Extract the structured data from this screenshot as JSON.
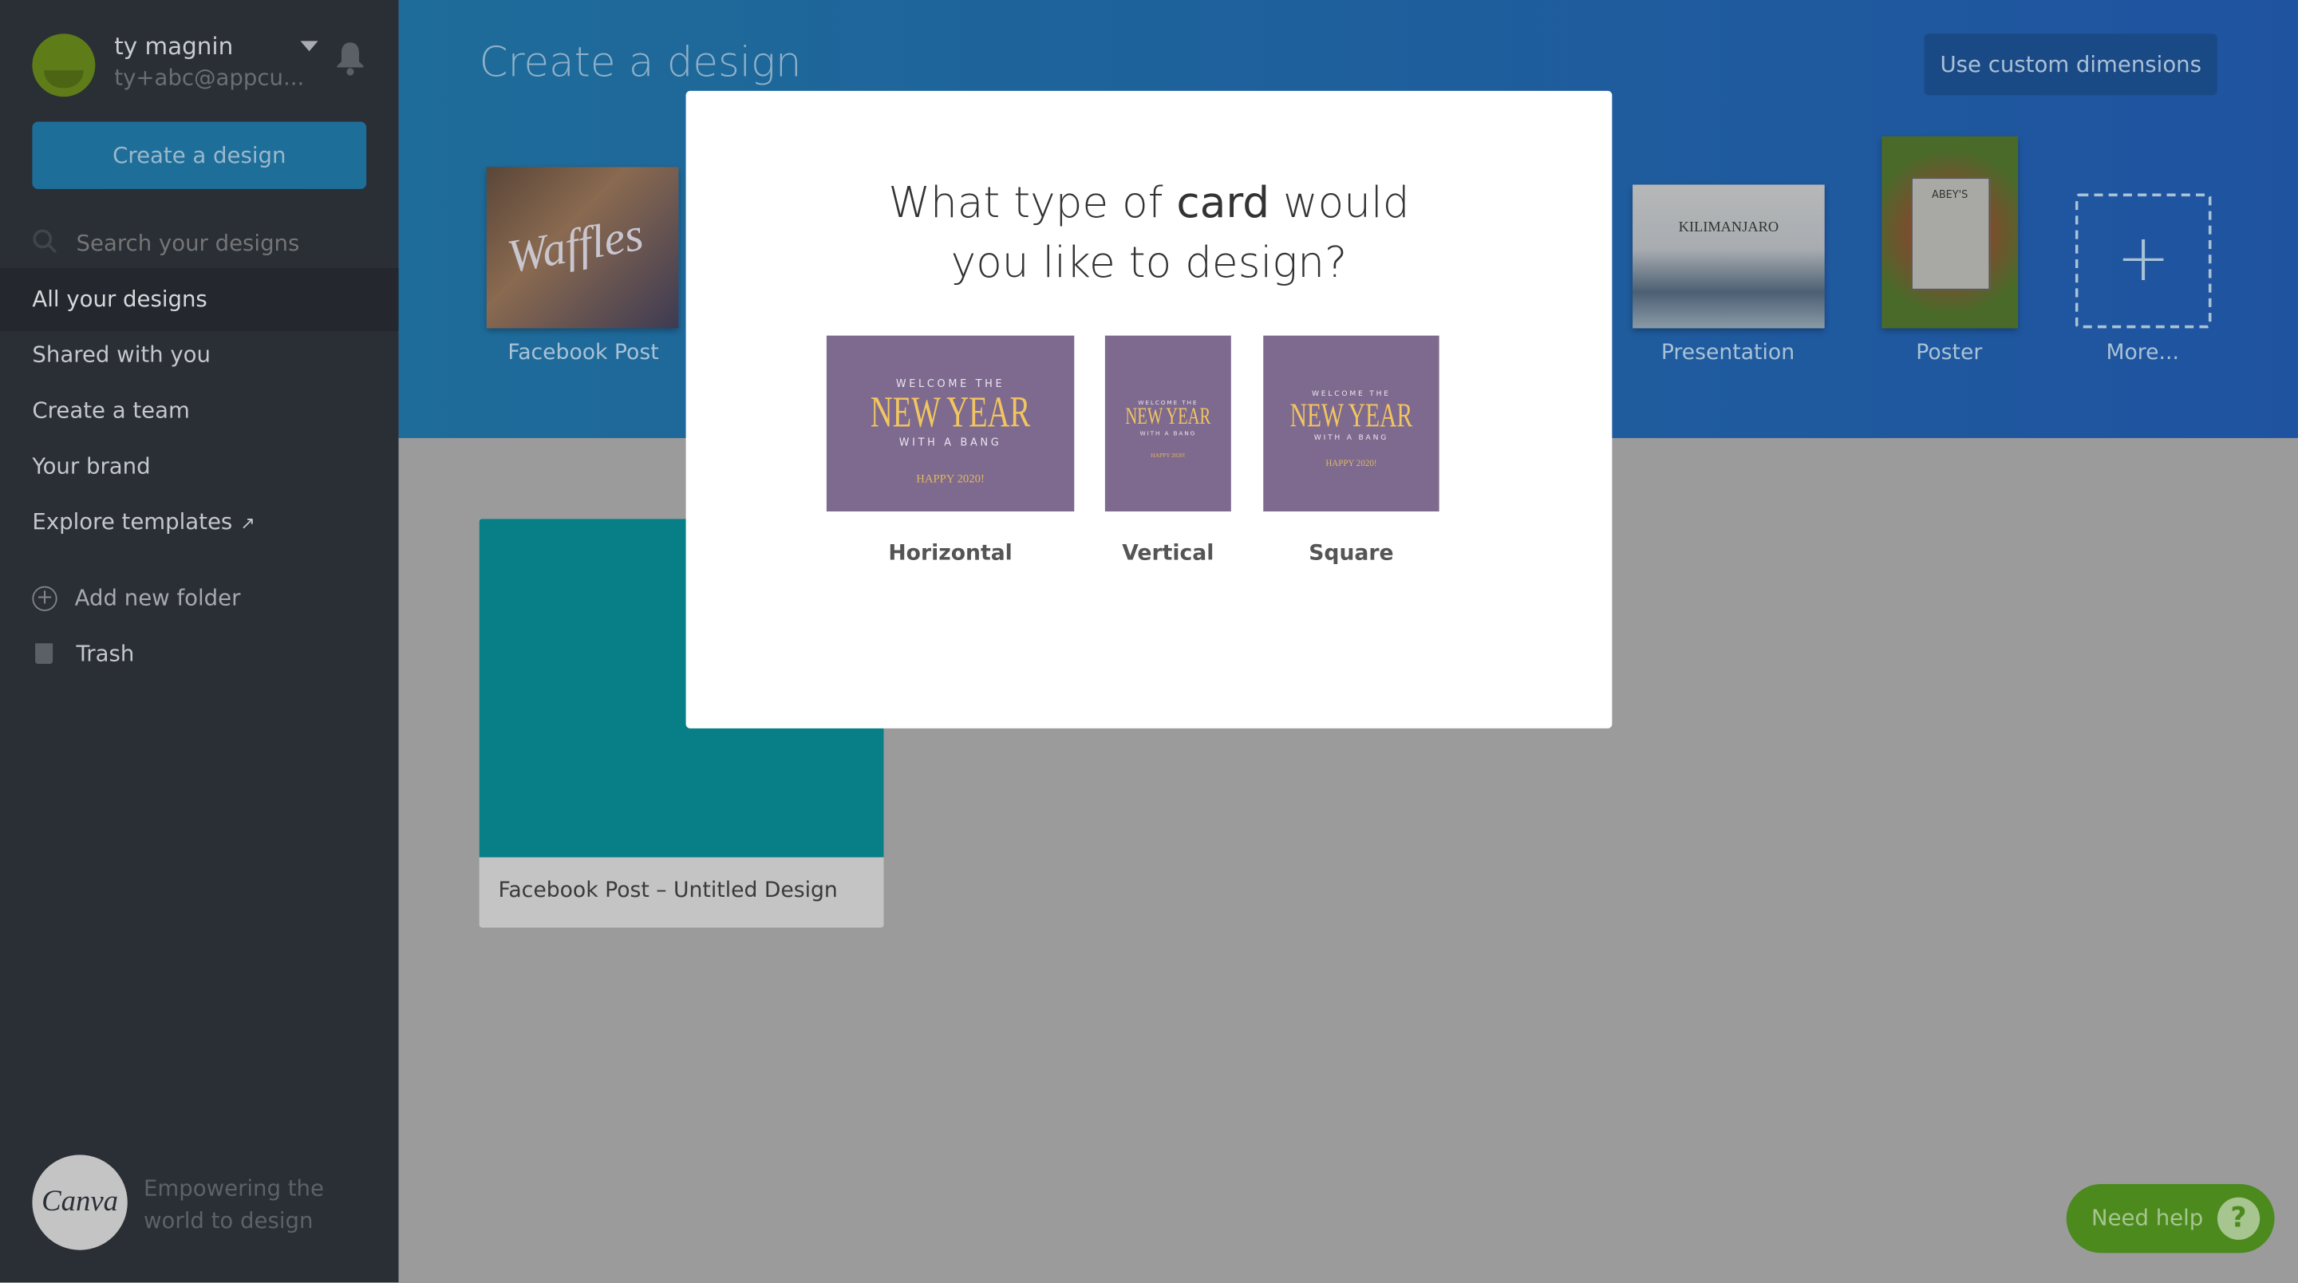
{
  "user": {
    "name": "ty magnin",
    "email": "ty+abc@appcu...",
    "avatar_color": "#5e7d18"
  },
  "sidebar": {
    "create_button": "Create a design",
    "search_placeholder": "Search your designs",
    "items": [
      {
        "label": "All your designs",
        "active": true
      },
      {
        "label": "Shared with you"
      },
      {
        "label": "Create a team"
      },
      {
        "label": "Your brand"
      },
      {
        "label": "Explore templates",
        "icon": "external-link-icon"
      }
    ],
    "add_folder": "Add new folder",
    "trash": "Trash",
    "tagline_1": "Empowering the",
    "tagline_2": "world to design",
    "logo": "Canva"
  },
  "header": {
    "title": "Create a design",
    "custom_dimensions": "Use custom dimensions",
    "design_types": [
      {
        "label": "Facebook Post",
        "thumb_text": "Waffles"
      },
      {
        "label": "Presentation",
        "thumb_text": "KILIMANJARO"
      },
      {
        "label": "Poster",
        "thumb_text": "ABEY'S"
      },
      {
        "label": "More..."
      }
    ]
  },
  "designs": [
    {
      "title": "Facebook Post – Untitled Design",
      "color": "#087f86"
    }
  ],
  "modal": {
    "title_pre": "What type of ",
    "title_bold": "card",
    "title_post": " would",
    "title_line2": "you like to design?",
    "card_text": {
      "welcome": "WELCOME THE",
      "new_year": "NEW YEAR",
      "bang": "WITH A BANG",
      "happy": "HAPPY 2020!"
    },
    "options": [
      "Horizontal",
      "Vertical",
      "Square"
    ]
  },
  "help": {
    "label": "Need help",
    "icon": "?"
  }
}
